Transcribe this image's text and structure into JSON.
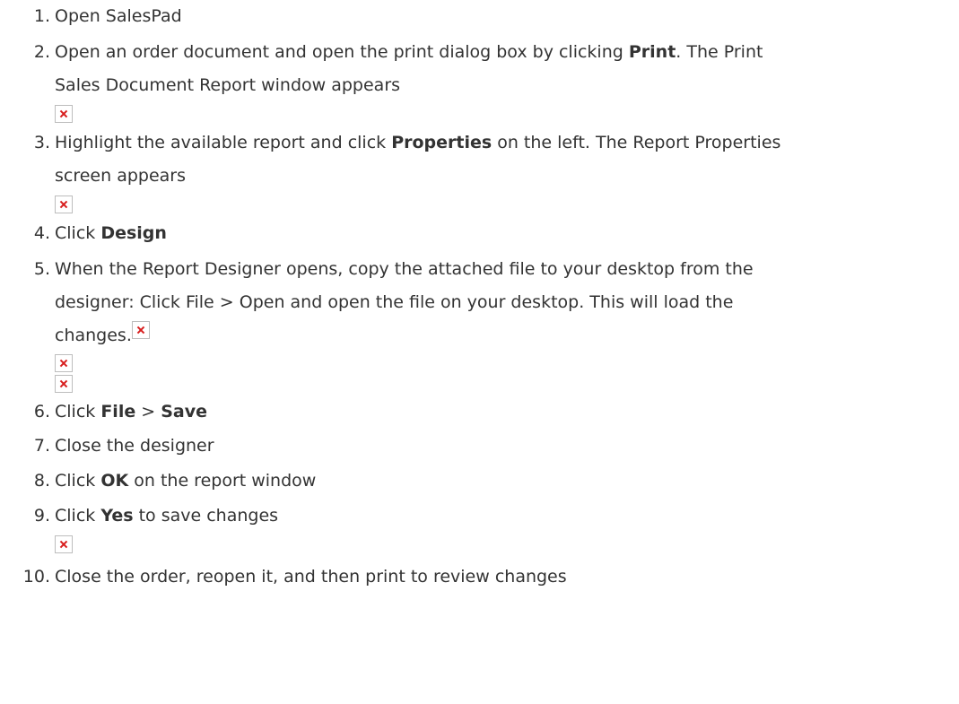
{
  "steps": [
    {
      "number": "1.",
      "text": "Open SalesPad"
    },
    {
      "number": "2.",
      "before": "Open an order document and open the print dialog box by clicking ",
      "bold": "Print",
      "after": ". The Print",
      "line2": "Sales Document Report window appears",
      "image": "broken-image-icon"
    },
    {
      "number": "3.",
      "before": "Highlight the available report and click ",
      "bold": "Properties",
      "after": " on the left. The Report Properties",
      "line2": "screen appears",
      "image": "broken-image-icon"
    },
    {
      "number": "4.",
      "before": "Click ",
      "bold": "Design"
    },
    {
      "number": "5.",
      "line1": "When the Report Designer opens, copy the attached file to your desktop from the",
      "line2": "designer: Click File > Open and open the file on your desktop. This will load the",
      "line3": "changes.",
      "images": [
        "broken-image-icon",
        "broken-image-icon",
        "broken-image-icon"
      ]
    },
    {
      "number": "6.",
      "before": "Click ",
      "bold": "File",
      "middle": " > ",
      "bold2": "Save"
    },
    {
      "number": "7.",
      "text": "Close the designer"
    },
    {
      "number": "8.",
      "before": "Click ",
      "bold": "OK",
      "after": " on the report window"
    },
    {
      "number": "9.",
      "before": "Click ",
      "bold": "Yes",
      "after": " to save changes",
      "image": "broken-image-icon"
    },
    {
      "number": "10.",
      "text": "Close the order, reopen it, and then print to review changes"
    }
  ]
}
